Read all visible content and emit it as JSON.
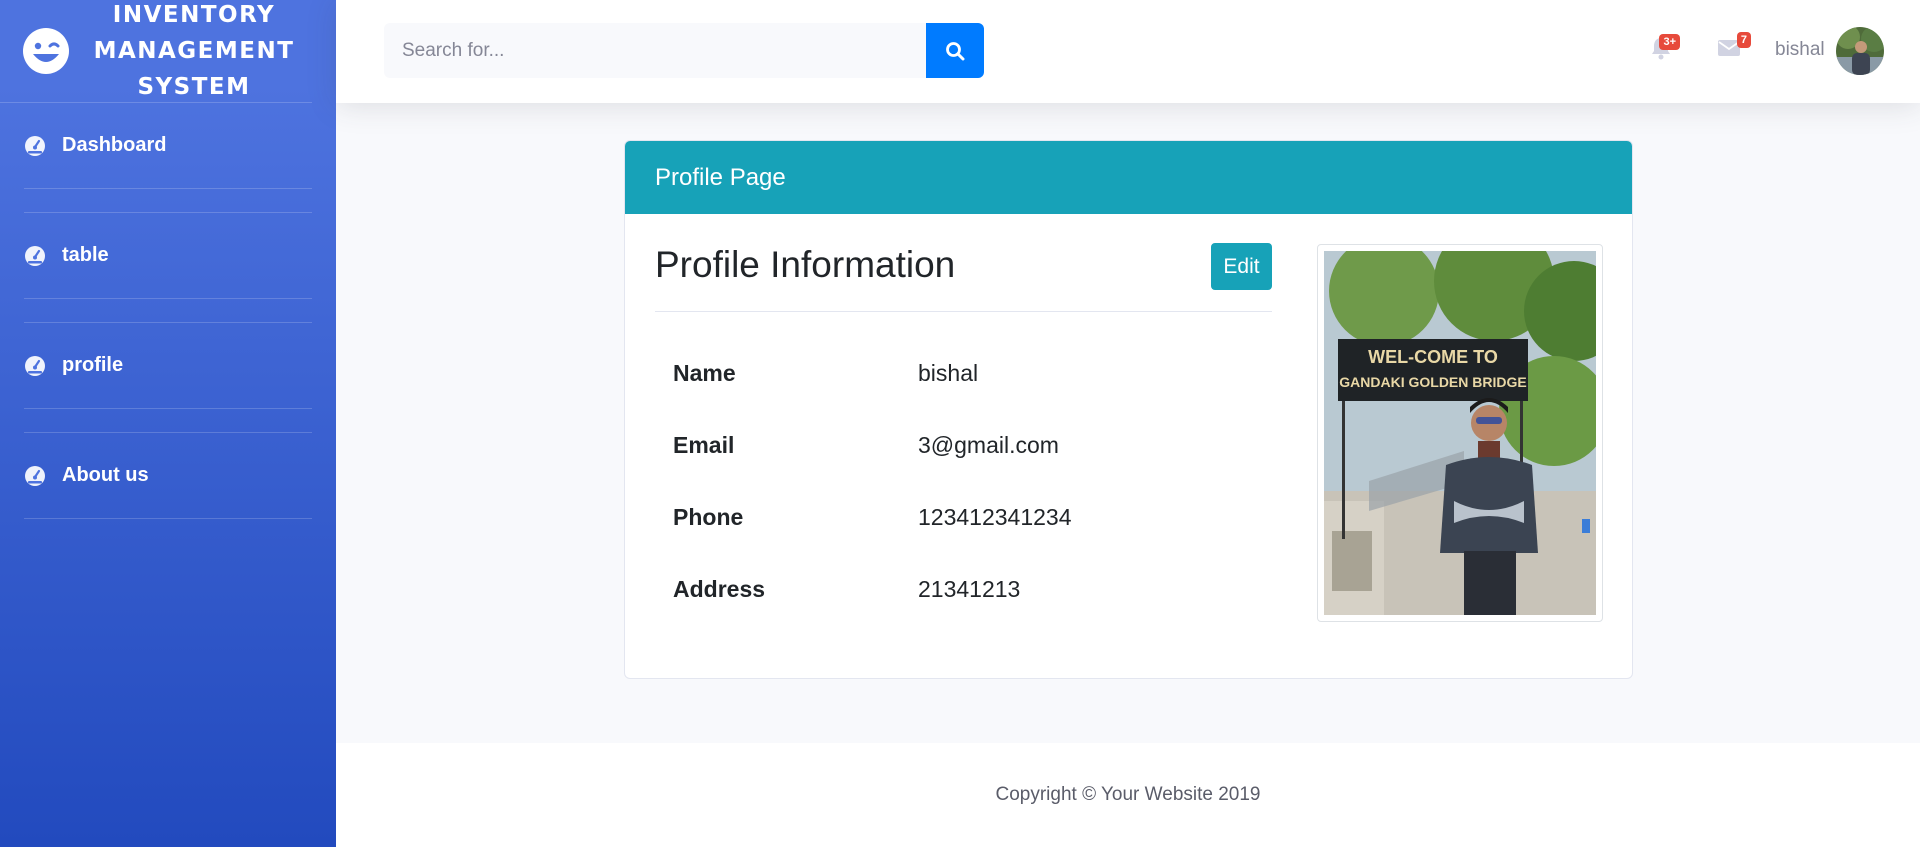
{
  "sidebar": {
    "brand": "INVENTORY MANAGEMENT SYSTEM",
    "items": [
      {
        "label": "Dashboard",
        "icon": "tachometer-icon"
      },
      {
        "label": "table",
        "icon": "tachometer-icon"
      },
      {
        "label": "profile",
        "icon": "tachometer-icon"
      },
      {
        "label": "About us",
        "icon": "tachometer-icon"
      }
    ]
  },
  "topbar": {
    "search_placeholder": "Search for...",
    "alerts_badge": "3+",
    "messages_badge": "7",
    "user_name": "bishal"
  },
  "profile": {
    "header": "Profile Page",
    "title": "Profile Information",
    "edit_label": "Edit",
    "fields": [
      {
        "label": "Name",
        "value": "bishal"
      },
      {
        "label": "Email",
        "value": "3@gmail.com"
      },
      {
        "label": "Phone",
        "value": "123412341234"
      },
      {
        "label": "Address",
        "value": "21341213"
      }
    ],
    "photo_sign_line1": "WEL-COME TO",
    "photo_sign_line2": "GANDAKI GOLDEN BRIDGE"
  },
  "footer": {
    "copyright": "Copyright © Your Website 2019"
  },
  "colors": {
    "sidebar_top": "#4e73df",
    "sidebar_bottom": "#224abe",
    "accent_blue": "#007bff",
    "info_teal": "#17a2b8",
    "badge_red": "#e74a3b"
  }
}
